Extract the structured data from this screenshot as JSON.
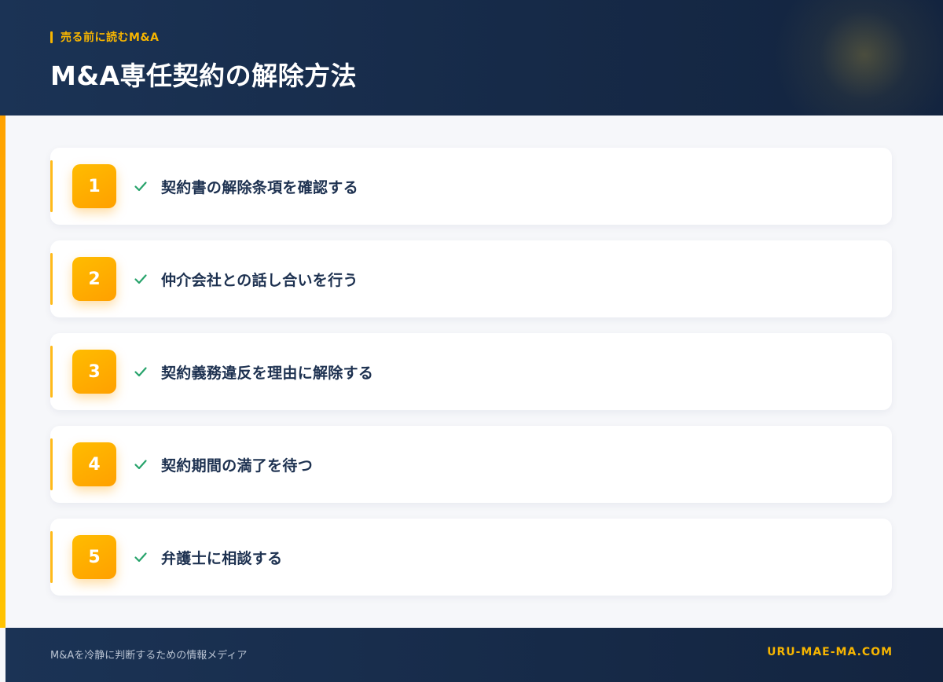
{
  "header": {
    "kicker": "売る前に読むM&A",
    "title": "M&A専任契約の解除方法"
  },
  "steps": [
    {
      "number": "1",
      "label": "契約書の解除条項を確認する"
    },
    {
      "number": "2",
      "label": "仲介会社との話し合いを行う"
    },
    {
      "number": "3",
      "label": "契約義務違反を理由に解除する"
    },
    {
      "number": "4",
      "label": "契約期間の満了を待つ"
    },
    {
      "number": "5",
      "label": "弁護士に相談する"
    }
  ],
  "footer": {
    "tagline": "M&Aを冷静に判断するための情報メディア",
    "site": "URU-MAE-MA.COM"
  },
  "colors": {
    "navy": "#1b3355",
    "accent": "#f7b500",
    "check": "#27a36b",
    "text": "#1d3150"
  },
  "icons": {
    "check": "check-icon"
  }
}
